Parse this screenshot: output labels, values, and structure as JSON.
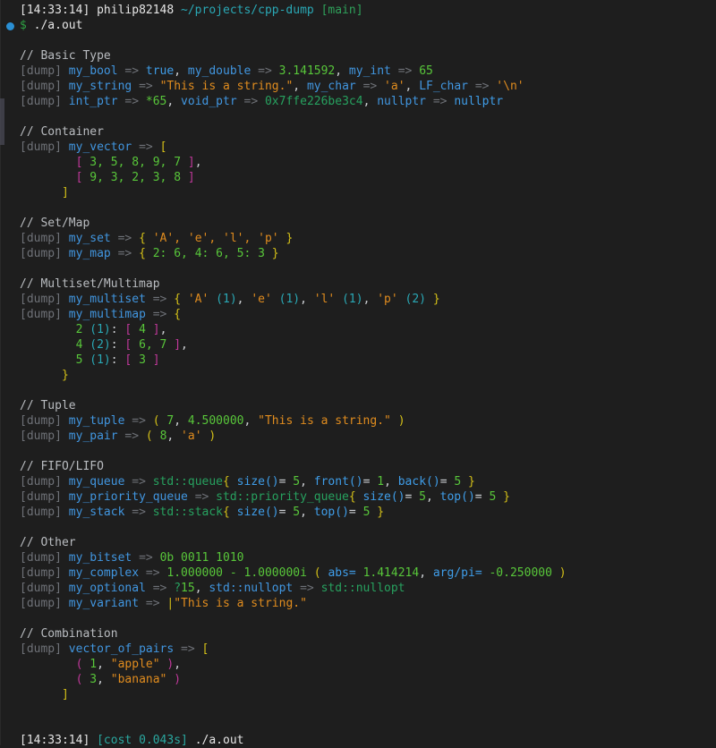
{
  "terminal": {
    "background": "#1e1e1e",
    "prompt_symbol": "$",
    "bullet_marker": "running-indicator",
    "colors": {
      "identifier": "#4196e0",
      "number": "#58c63a",
      "string": "#e08c1e",
      "type": "#27a15f",
      "bracket_outer": "#d4c018",
      "bracket_inner": "#c0389a",
      "cyan": "#2aa8b5",
      "dim": "#6e7177"
    }
  },
  "prompt": {
    "time": "[14:33:14]",
    "user": "philip82148",
    "path": "~/projects/cpp-dump",
    "branch": "[main]",
    "symbol": "$",
    "command": "./a.out"
  },
  "footer": {
    "time": "[14:33:14]",
    "cost": "[cost 0.043s]",
    "command": "./a.out"
  },
  "sections": [
    {
      "heading": "// Basic Type"
    },
    {
      "heading": "// Container"
    },
    {
      "heading": "// Set/Map"
    },
    {
      "heading": "// Multiset/Multimap"
    },
    {
      "heading": "// Tuple"
    },
    {
      "heading": "// FIFO/LIFO"
    },
    {
      "heading": "// Other"
    },
    {
      "heading": "// Combination"
    }
  ],
  "tokens": {
    "dump": "[dump]",
    "arrow": "=>",
    "comma": ",",
    "colon": ":"
  },
  "output": {
    "basic_type": {
      "heading": "// Basic Type",
      "line1": {
        "name1": "my_bool",
        "val1": "true",
        "name2": "my_double",
        "val2": "3.141592",
        "name3": "my_int",
        "val3": "65"
      },
      "line2": {
        "name1": "my_string",
        "val1": "\"This is a string.\"",
        "name2": "my_char",
        "val2": "'a'",
        "name3": "LF_char",
        "val3": "'\\n'"
      },
      "line3": {
        "name1": "int_ptr",
        "val1": "*65",
        "name2": "void_ptr",
        "val2": "0x7ffe226be3c4",
        "name3": "nullptr",
        "val3": "nullptr"
      }
    },
    "container": {
      "heading": "// Container",
      "name": "my_vector",
      "open": "[",
      "rows": [
        {
          "open": "[",
          "values": "3, 5, 8, 9, 7",
          "close": "]",
          "trail": ","
        },
        {
          "open": "[",
          "values": "9, 3, 2, 3, 8",
          "close": "]",
          "trail": ""
        }
      ],
      "close": "]"
    },
    "set_map": {
      "heading": "// Set/Map",
      "set": {
        "name": "my_set",
        "open": "{",
        "items": "'A', 'e', 'l', 'p'",
        "close": "}"
      },
      "map": {
        "name": "my_map",
        "open": "{",
        "items": "2: 6, 4: 6, 5: 3",
        "close": "}"
      }
    },
    "multiset_multimap": {
      "heading": "// Multiset/Multimap",
      "multiset": {
        "name": "my_multiset",
        "open": "{",
        "entries": [
          {
            "key": "'A'",
            "count": "(1)"
          },
          {
            "key": "'e'",
            "count": "(1)"
          },
          {
            "key": "'l'",
            "count": "(1)"
          },
          {
            "key": "'p'",
            "count": "(2)"
          }
        ],
        "close": "}"
      },
      "multimap": {
        "name": "my_multimap",
        "open": "{",
        "rows": [
          {
            "key": "2",
            "count": "(1)",
            "open": "[",
            "values": "4",
            "close": "]",
            "trail": ","
          },
          {
            "key": "4",
            "count": "(2)",
            "open": "[",
            "values": "6, 7",
            "close": "]",
            "trail": ","
          },
          {
            "key": "5",
            "count": "(1)",
            "open": "[",
            "values": "3",
            "close": "]",
            "trail": ""
          }
        ],
        "close": "}"
      }
    },
    "tuple": {
      "heading": "// Tuple",
      "tuple": {
        "name": "my_tuple",
        "open": "(",
        "v1": "7",
        "v2": "4.500000",
        "v3": "\"This is a string.\"",
        "close": ")"
      },
      "pair": {
        "name": "my_pair",
        "open": "(",
        "v1": "8",
        "v2": "'a'",
        "close": ")"
      }
    },
    "fifo_lifo": {
      "heading": "// FIFO/LIFO",
      "queue": {
        "name": "my_queue",
        "type": "std::queue",
        "open": "{",
        "close": "}",
        "fields": [
          {
            "fn": "size()",
            "eq": "=",
            "val": "5"
          },
          {
            "fn": "front()",
            "eq": "=",
            "val": "1"
          },
          {
            "fn": "back()",
            "eq": "=",
            "val": "5"
          }
        ]
      },
      "priority_queue": {
        "name": "my_priority_queue",
        "type": "std::priority_queue",
        "open": "{",
        "close": "}",
        "fields": [
          {
            "fn": "size()",
            "eq": "=",
            "val": "5"
          },
          {
            "fn": "top()",
            "eq": "=",
            "val": "5"
          }
        ]
      },
      "stack": {
        "name": "my_stack",
        "type": "std::stack",
        "open": "{",
        "close": "}",
        "fields": [
          {
            "fn": "size()",
            "eq": "=",
            "val": "5"
          },
          {
            "fn": "top()",
            "eq": "=",
            "val": "5"
          }
        ]
      }
    },
    "other": {
      "heading": "// Other",
      "bitset": {
        "name": "my_bitset",
        "val": "0b 0011 1010"
      },
      "complex": {
        "name": "my_complex",
        "real": "1.000000",
        "op": "-",
        "imag": "1.000000i",
        "open": "(",
        "abs_label": "abs=",
        "abs": "1.414214",
        "arg_label": "arg/pi=",
        "arg": "-0.250000",
        "close": ")"
      },
      "optional": {
        "name": "my_optional",
        "q": "?",
        "val": "15",
        "name2": "std::nullopt",
        "val2": "std::nullopt"
      },
      "variant": {
        "name": "my_variant",
        "bar": "|",
        "val": "\"This is a string.\""
      }
    },
    "combination": {
      "heading": "// Combination",
      "name": "vector_of_pairs",
      "open": "[",
      "rows": [
        {
          "open": "(",
          "v1": "1",
          "v2": "\"apple\"",
          "close": ")",
          "trail": ","
        },
        {
          "open": "(",
          "v1": "3",
          "v2": "\"banana\"",
          "close": ")",
          "trail": ""
        }
      ],
      "close": "]"
    }
  }
}
